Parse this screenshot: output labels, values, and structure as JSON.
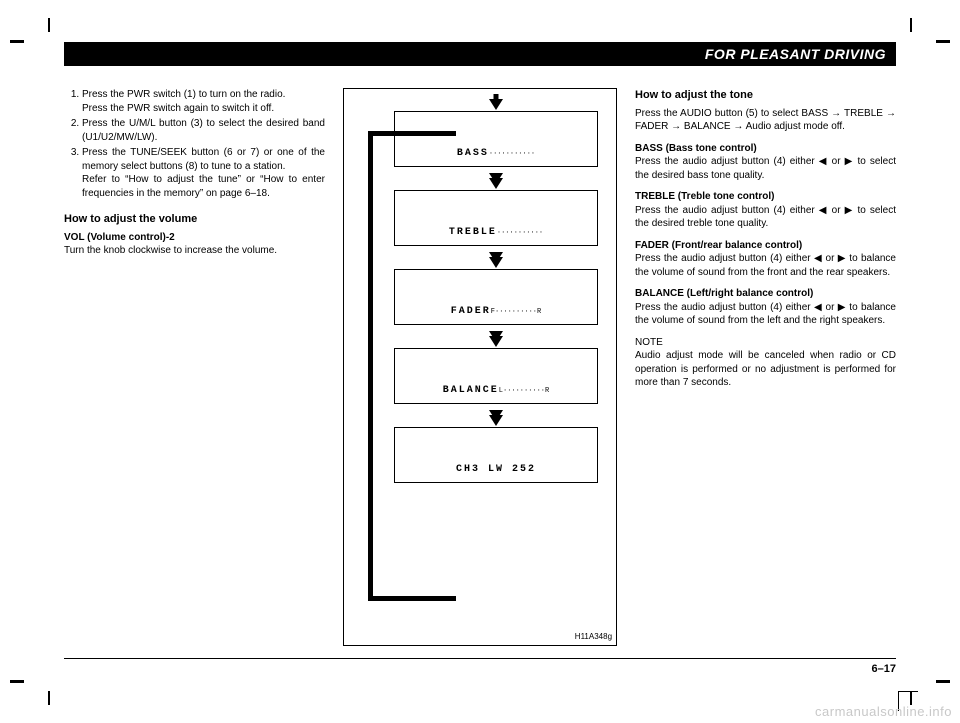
{
  "header": {
    "title": "FOR PLEASANT DRIVING"
  },
  "left": {
    "steps": [
      {
        "main": "Press the PWR switch (1) to turn on the radio.",
        "sub": "Press the PWR switch again to switch it off."
      },
      {
        "main": "Press the U/M/L button (3) to select the desired band (U1/U2/MW/LW).",
        "sub": ""
      },
      {
        "main": "Press the TUNE/SEEK button (6 or 7) or one of the memory select buttons (8) to tune to a station.",
        "sub": "Refer to “How to adjust the tune” or “How to enter frequencies in the memory” on page 6–18."
      }
    ],
    "h_volume": "How to adjust the volume",
    "vol_sub": "VOL (Volume control)-2",
    "vol_body": "Turn the knob clockwise to increase the volume."
  },
  "figure": {
    "rows": [
      {
        "label": "BASS",
        "suffix": "···········"
      },
      {
        "label": "TREBLE",
        "suffix": "···········"
      },
      {
        "label": "FADER",
        "suffix": "F··········R"
      },
      {
        "label": "BALANCE",
        "suffix": "L··········R"
      },
      {
        "label": "CH3  LW   252",
        "suffix": ""
      }
    ],
    "code": "H11A348g"
  },
  "right": {
    "h_tone": "How to adjust the tone",
    "tone_intro": "Press the AUDIO button (5) to select BASS → TREBLE → FADER → BALANCE → Audio adjust mode off.",
    "bass_h": "BASS (Bass tone control)",
    "bass_b": "Press the audio adjust button (4) either ◀ or ▶ to select the desired bass tone quality.",
    "treble_h": "TREBLE (Treble tone control)",
    "treble_b": "Press the audio adjust button (4) either ◀ or ▶ to select the desired treble tone quality.",
    "fader_h": "FADER (Front/rear balance control)",
    "fader_b": "Press the audio adjust button (4) either ◀ or ▶ to balance the volume of sound from the front and the rear speakers.",
    "balance_h": "BALANCE (Left/right balance control)",
    "balance_b": "Press the audio adjust button (4) either ◀ or ▶ to balance the volume of sound from the left and the right speakers.",
    "note_h": "NOTE",
    "note_b": "Audio adjust mode will be canceled when radio or CD operation is performed or no adjustment is performed for more than 7 seconds."
  },
  "footer": {
    "page": "6–17"
  },
  "watermark": "carmanualsonline.info"
}
